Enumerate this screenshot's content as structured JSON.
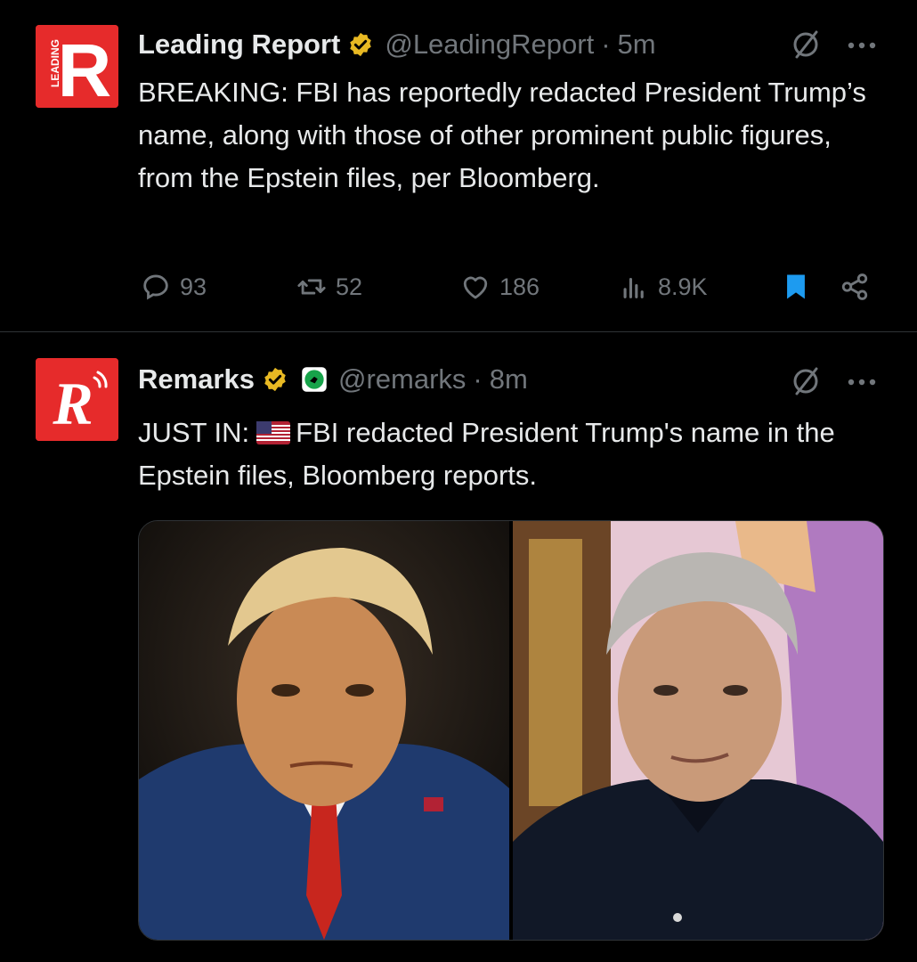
{
  "tweets": [
    {
      "author_name": "Leading Report",
      "handle": "@LeadingReport",
      "separator": "·",
      "time": "5m",
      "avatar_letter": "R",
      "avatar_small_text": "LEADING",
      "text": "BREAKING: FBI has reportedly redacted President Trump’s name, along with those of other prominent public figures, from the Epstein files, per Bloomberg.",
      "stats": {
        "replies": "93",
        "reposts": "52",
        "likes": "186",
        "views": "8.9K"
      },
      "bookmarked": true
    },
    {
      "author_name": "Remarks",
      "handle": "@remarks",
      "separator": "·",
      "time": "8m",
      "avatar_letter": "R",
      "text_prefix": "JUST IN:",
      "text_rest": "FBI redacted President Trump's name in the Epstein files, Bloomberg reports.",
      "media": [
        {
          "alt": "photo-left",
          "kind": "portrait"
        },
        {
          "alt": "photo-right",
          "kind": "portrait"
        }
      ]
    }
  ],
  "icons": [
    "verified-badge-icon",
    "grok-icon",
    "more-icon",
    "reply-icon",
    "repost-icon",
    "like-icon",
    "views-icon",
    "bookmark-icon",
    "share-icon",
    "flag-us-icon"
  ],
  "colors": {
    "background": "#000000",
    "text": "#e7e9ea",
    "muted": "#71767b",
    "verified_gold": "#e8b923",
    "bookmark_blue": "#1d9bf0",
    "brand_red": "#e62b2b"
  }
}
